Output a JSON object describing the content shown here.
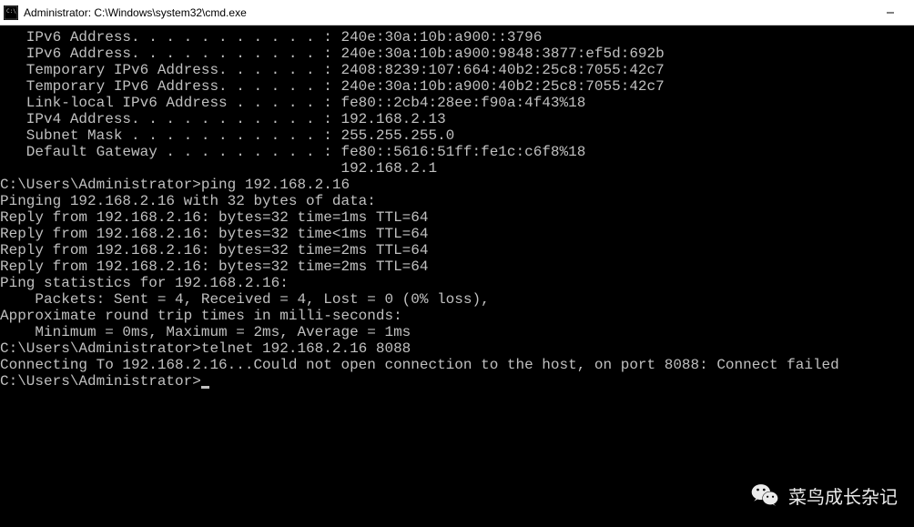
{
  "window": {
    "title": "Administrator: C:\\Windows\\system32\\cmd.exe"
  },
  "terminal": {
    "lines": [
      "   IPv6 Address. . . . . . . . . . . : 240e:30a:10b:a900::3796",
      "   IPv6 Address. . . . . . . . . . . : 240e:30a:10b:a900:9848:3877:ef5d:692b",
      "   Temporary IPv6 Address. . . . . . : 2408:8239:107:664:40b2:25c8:7055:42c7",
      "   Temporary IPv6 Address. . . . . . : 240e:30a:10b:a900:40b2:25c8:7055:42c7",
      "   Link-local IPv6 Address . . . . . : fe80::2cb4:28ee:f90a:4f43%18",
      "   IPv4 Address. . . . . . . . . . . : 192.168.2.13",
      "   Subnet Mask . . . . . . . . . . . : 255.255.255.0",
      "   Default Gateway . . . . . . . . . : fe80::5616:51ff:fe1c:c6f8%18",
      "                                       192.168.2.1",
      "",
      "C:\\Users\\Administrator>ping 192.168.2.16",
      "",
      "Pinging 192.168.2.16 with 32 bytes of data:",
      "Reply from 192.168.2.16: bytes=32 time=1ms TTL=64",
      "Reply from 192.168.2.16: bytes=32 time<1ms TTL=64",
      "Reply from 192.168.2.16: bytes=32 time=2ms TTL=64",
      "Reply from 192.168.2.16: bytes=32 time=2ms TTL=64",
      "",
      "Ping statistics for 192.168.2.16:",
      "    Packets: Sent = 4, Received = 4, Lost = 0 (0% loss),",
      "Approximate round trip times in milli-seconds:",
      "    Minimum = 0ms, Maximum = 2ms, Average = 1ms",
      "",
      "C:\\Users\\Administrator>telnet 192.168.2.16 8088",
      "Connecting To 192.168.2.16...Could not open connection to the host, on port 8088: Connect failed",
      "",
      "C:\\Users\\Administrator>"
    ]
  },
  "watermark": {
    "text": "菜鸟成长杂记"
  }
}
